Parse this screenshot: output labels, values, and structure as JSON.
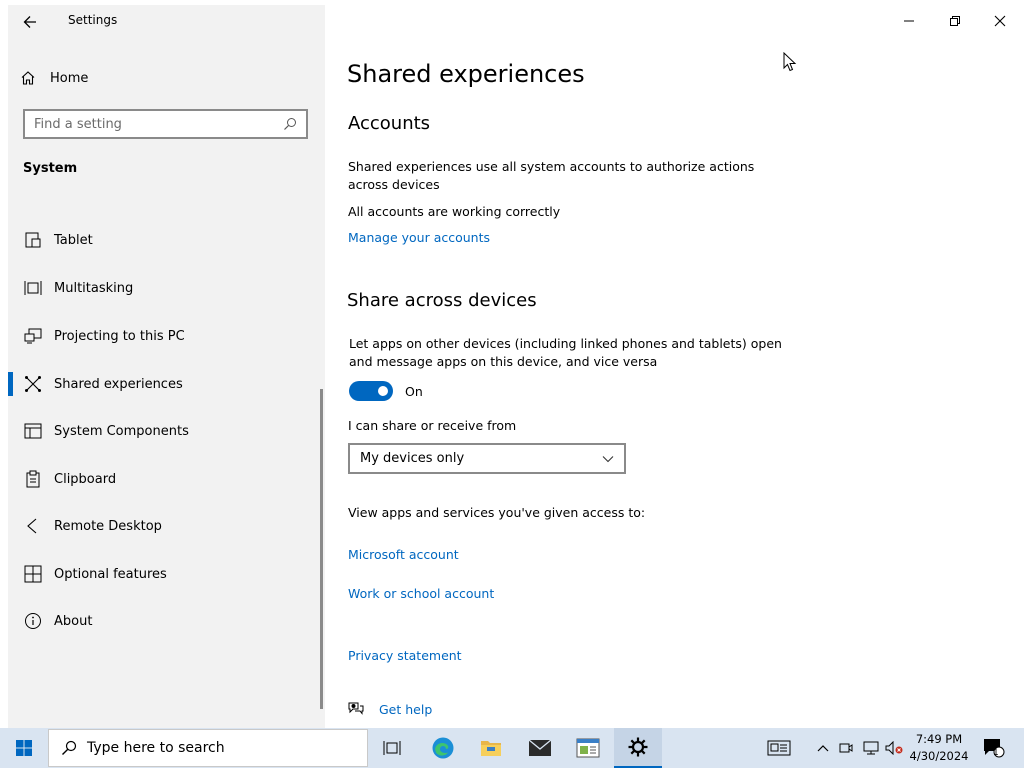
{
  "window": {
    "app_title": "Settings"
  },
  "sidebar": {
    "home_label": "Home",
    "search_placeholder": "Find a setting",
    "section_label": "System",
    "items": [
      {
        "label": "Tablet",
        "icon": "tablet-icon"
      },
      {
        "label": "Multitasking",
        "icon": "multitasking-icon"
      },
      {
        "label": "Projecting to this PC",
        "icon": "projecting-icon"
      },
      {
        "label": "Shared experiences",
        "icon": "shared-experiences-icon",
        "selected": true
      },
      {
        "label": "System Components",
        "icon": "system-components-icon"
      },
      {
        "label": "Clipboard",
        "icon": "clipboard-icon"
      },
      {
        "label": "Remote Desktop",
        "icon": "remote-desktop-icon"
      },
      {
        "label": "Optional features",
        "icon": "optional-features-icon"
      },
      {
        "label": "About",
        "icon": "about-icon"
      }
    ]
  },
  "main": {
    "page_title": "Shared experiences",
    "accounts": {
      "heading": "Accounts",
      "description": "Shared experiences use all system accounts to authorize actions across devices",
      "status": "All accounts are working correctly",
      "manage_link": "Manage your accounts"
    },
    "share": {
      "heading": "Share across devices",
      "description": "Let apps on other devices (including linked phones and tablets) open and message apps on this device, and vice versa",
      "toggle_state": "On",
      "share_from_label": "I can share or receive from",
      "dropdown_value": "My devices only",
      "view_apps_label": "View apps and services you've given access to:",
      "microsoft_account_link": "Microsoft account",
      "work_school_link": "Work or school account"
    },
    "privacy_link": "Privacy statement",
    "get_help_link": "Get help"
  },
  "taskbar": {
    "search_placeholder": "Type here to search",
    "time": "7:49 PM",
    "date": "4/30/2024",
    "notification_count": "1"
  },
  "colors": {
    "accent": "#0067c0",
    "sidebar_bg": "#f2f2f2",
    "taskbar_bg": "#d9e4f1"
  }
}
